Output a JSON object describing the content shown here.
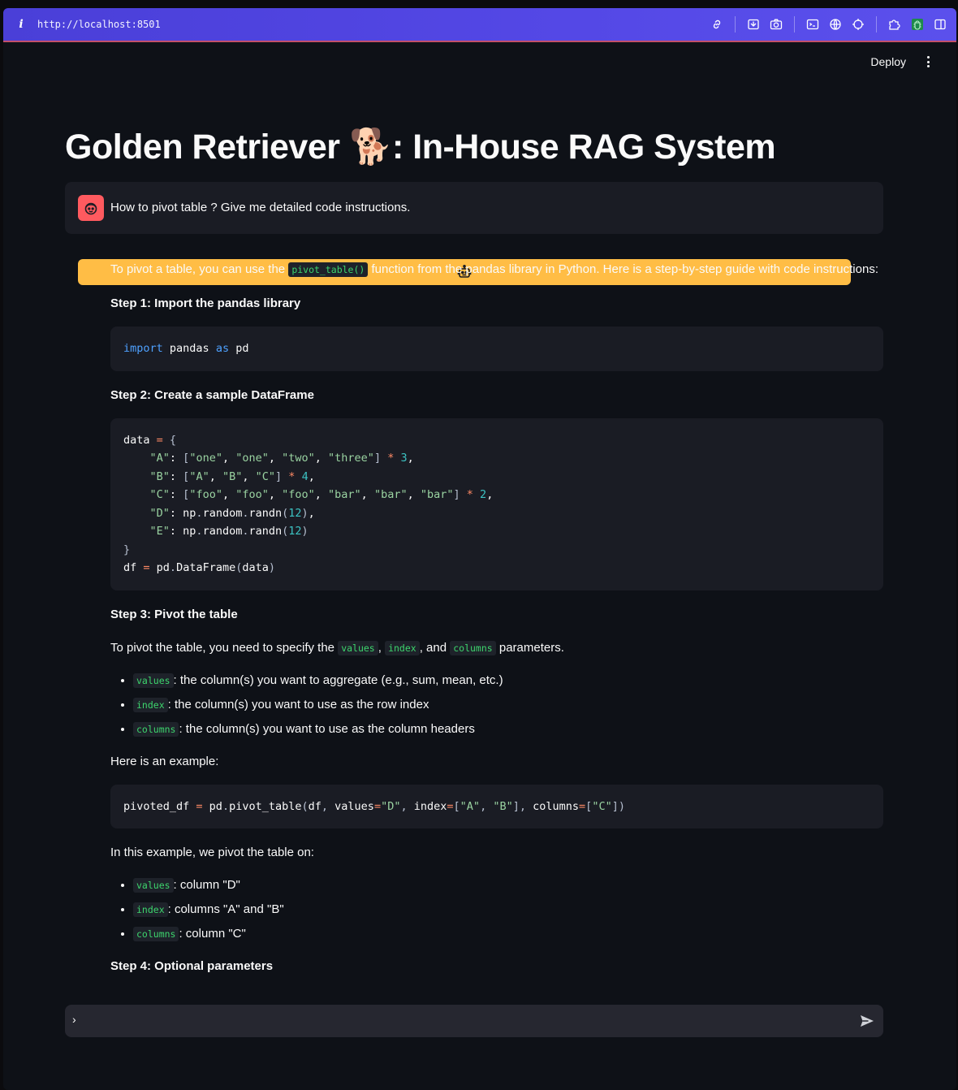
{
  "browser": {
    "url": "http://localhost:8501",
    "icons": [
      "link-icon",
      "screen-record-icon",
      "camera-icon",
      "terminal-icon",
      "globe-icon",
      "crosshair-icon",
      "extension-icon",
      "bug-icon",
      "sidebar-toggle-icon"
    ]
  },
  "header": {
    "deploy_label": "Deploy"
  },
  "page": {
    "title_part1": "Golden Retriever ",
    "title_emoji": "🐕",
    "title_part2": ": In-House RAG System"
  },
  "user_message": "How to pivot table ? Give me detailed code instructions.",
  "assistant": {
    "intro_before": "To pivot a table, you can use the ",
    "intro_code": "pivot_table()",
    "intro_after": " function from the pandas library in Python. Here is a step-by-step guide with code instructions:",
    "step1": "Step 1: Import the pandas library",
    "step2": "Step 2: Create a sample DataFrame",
    "step3": "Step 3: Pivot the table",
    "step3_text_a": "To pivot the table, you need to specify the ",
    "step3_code_values": "values",
    "step3_sep1": ", ",
    "step3_code_index": "index",
    "step3_sep2": ", and ",
    "step3_code_columns": "columns",
    "step3_text_b": " parameters.",
    "params": [
      {
        "code": "values",
        "text": ": the column(s) you want to aggregate (e.g., sum, mean, etc.)"
      },
      {
        "code": "index",
        "text": ": the column(s) you want to use as the row index"
      },
      {
        "code": "columns",
        "text": ": the column(s) you want to use as the column headers"
      }
    ],
    "example_label": "Here is an example:",
    "example_explain": "In this example, we pivot the table on:",
    "example_params": [
      {
        "code": "values",
        "text": ": column \"D\""
      },
      {
        "code": "index",
        "text": ": columns \"A\" and \"B\""
      },
      {
        "code": "columns",
        "text": ": column \"C\""
      }
    ],
    "step4": "Step 4: Optional parameters"
  },
  "chat_input": {
    "prompt_glyph": "›"
  },
  "colors": {
    "topbar": "#5448e6",
    "user_avatar": "#ff5a5f",
    "bot_avatar": "#ffbd45",
    "inline_code": "#3dd56d"
  }
}
